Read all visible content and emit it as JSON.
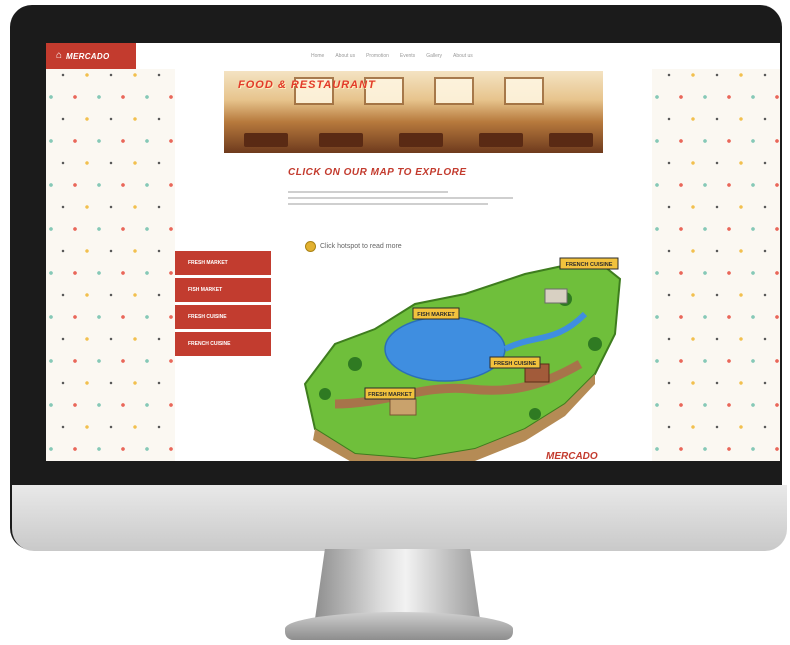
{
  "site": {
    "logo_text": "MERCADO",
    "nav": [
      "Home",
      "About us",
      "Promotion",
      "Events",
      "Gallery",
      "About us"
    ],
    "banner_title": "FOOD & RESTAURANT",
    "headline": "CLICK ON OUR MAP TO EXPLORE",
    "hotspot_hint": "Click hotspot to read more",
    "menu": [
      "FRESH MARKET",
      "FISH MARKET",
      "FRESH CUISINE",
      "FRENCH CUISINE"
    ],
    "map_labels": [
      "FRENCH CUISINE",
      "FISH MARKET",
      "FRESH CUISINE",
      "FRESH MARKET"
    ],
    "footer_logo": "MERCADO"
  },
  "colors": {
    "accent": "#c33b2e",
    "hotspot": "#e2b130",
    "water": "#3f8ee0",
    "grass": "#6fbf3b"
  },
  "icons": [
    "home-icon",
    "hotspot-marker-icon"
  ]
}
